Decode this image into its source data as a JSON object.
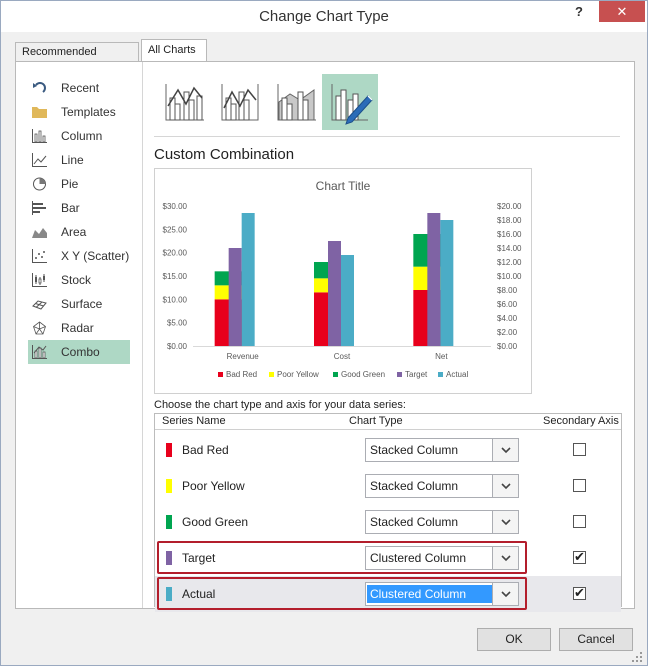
{
  "window": {
    "title": "Change Chart Type",
    "help_label": "?",
    "close_label": "✕"
  },
  "tabs": [
    {
      "label": "Recommended Charts",
      "active": false
    },
    {
      "label": "All Charts",
      "active": true
    }
  ],
  "sidebar": {
    "items": [
      {
        "label": "Recent",
        "icon": "recent-icon"
      },
      {
        "label": "Templates",
        "icon": "folder-icon"
      },
      {
        "label": "Column",
        "icon": "column-chart-icon"
      },
      {
        "label": "Line",
        "icon": "line-chart-icon"
      },
      {
        "label": "Pie",
        "icon": "pie-chart-icon"
      },
      {
        "label": "Bar",
        "icon": "bar-chart-icon"
      },
      {
        "label": "Area",
        "icon": "area-chart-icon"
      },
      {
        "label": "X Y (Scatter)",
        "icon": "scatter-chart-icon"
      },
      {
        "label": "Stock",
        "icon": "stock-chart-icon"
      },
      {
        "label": "Surface",
        "icon": "surface-chart-icon"
      },
      {
        "label": "Radar",
        "icon": "radar-chart-icon"
      },
      {
        "label": "Combo",
        "icon": "combo-chart-icon",
        "selected": true
      }
    ]
  },
  "subtypes": [
    {
      "name": "clustered-column-line-icon"
    },
    {
      "name": "clustered-column-line-secondary-icon"
    },
    {
      "name": "stacked-area-clustered-column-icon"
    },
    {
      "name": "custom-combination-icon",
      "selected": true
    }
  ],
  "section_title": "Custom Combination",
  "chart_data": {
    "type": "bar",
    "title": "Chart Title",
    "categories": [
      "Revenue",
      "Cost",
      "Net"
    ],
    "y_left": {
      "min": 0,
      "max": 30,
      "ticks": [
        "$0.00",
        "$5.00",
        "$10.00",
        "$15.00",
        "$20.00",
        "$25.00",
        "$30.00"
      ]
    },
    "y_right": {
      "min": 0,
      "max": 20,
      "ticks": [
        "$0.00",
        "$2.00",
        "$4.00",
        "$6.00",
        "$8.00",
        "$10.00",
        "$12.00",
        "$14.00",
        "$16.00",
        "$18.00",
        "$20.00"
      ]
    },
    "series": [
      {
        "name": "Bad Red",
        "color": "#e8001c",
        "chart_type": "stacked",
        "axis": "primary",
        "values": [
          10,
          11.5,
          12
        ]
      },
      {
        "name": "Poor Yellow",
        "color": "#ffff00",
        "chart_type": "stacked",
        "axis": "primary",
        "values": [
          3,
          3,
          5
        ]
      },
      {
        "name": "Good Green",
        "color": "#00a550",
        "chart_type": "stacked",
        "axis": "primary",
        "values": [
          3,
          3.5,
          7
        ]
      },
      {
        "name": "Target",
        "color": "#7f63a4",
        "chart_type": "clustered",
        "axis": "secondary",
        "values": [
          14,
          15,
          19
        ]
      },
      {
        "name": "Actual",
        "color": "#4bacc6",
        "chart_type": "clustered",
        "axis": "secondary",
        "values": [
          19,
          13,
          18
        ]
      }
    ],
    "legend": "bottom"
  },
  "choose_label": "Choose the chart type and axis for your data series:",
  "grid": {
    "headers": {
      "series": "Series Name",
      "type": "Chart Type",
      "axis": "Secondary Axis"
    },
    "rows": [
      {
        "name": "Bad Red",
        "color": "#e8001c",
        "type": "Stacked Column",
        "secondary": false
      },
      {
        "name": "Poor Yellow",
        "color": "#ffff00",
        "type": "Stacked Column",
        "secondary": false
      },
      {
        "name": "Good Green",
        "color": "#00a550",
        "type": "Stacked Column",
        "secondary": false
      },
      {
        "name": "Target",
        "color": "#7f63a4",
        "type": "Clustered Column",
        "secondary": true
      },
      {
        "name": "Actual",
        "color": "#4bacc6",
        "type": "Clustered Column",
        "secondary": true
      }
    ]
  },
  "buttons": {
    "ok": "OK",
    "cancel": "Cancel"
  },
  "check_glyph": "✔"
}
